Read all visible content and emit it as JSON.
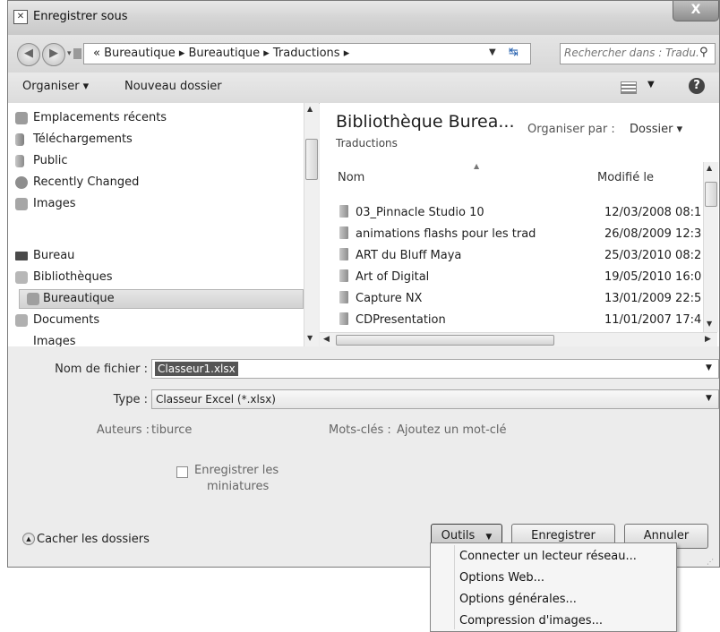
{
  "window": {
    "title": "Enregistrer sous",
    "close_glyph": "X"
  },
  "address": {
    "crumbs": "«  Bureautique  ▸  Bureautique  ▸  Traductions  ▸",
    "search_placeholder": "Rechercher dans : Tradu..."
  },
  "toolbar": {
    "organise": "Organiser ▾",
    "new_folder": "Nouveau dossier"
  },
  "nav": {
    "items": [
      {
        "label": "Emplacements récents"
      },
      {
        "label": "Téléchargements"
      },
      {
        "label": "Public"
      },
      {
        "label": "Recently Changed"
      },
      {
        "label": "Images"
      },
      {
        "label": "Bureau"
      },
      {
        "label": "Bibliothèques"
      },
      {
        "label": "Bureautique"
      },
      {
        "label": "Documents"
      },
      {
        "label": "Images"
      }
    ]
  },
  "library": {
    "title": "Bibliothèque Burea...",
    "subtitle": "Traductions",
    "arrange_label": "Organiser par :",
    "arrange_value": "Dossier ▾"
  },
  "files": {
    "col_name": "Nom",
    "col_modified": "Modifié le",
    "rows": [
      {
        "name": "03_Pinnacle Studio 10",
        "date": "12/03/2008 08:1"
      },
      {
        "name": "animations flashs pour les trad",
        "date": "26/08/2009 12:3"
      },
      {
        "name": "ART du Bluff Maya",
        "date": "25/03/2010 08:2"
      },
      {
        "name": "Art of Digital",
        "date": "19/05/2010 16:0"
      },
      {
        "name": "Capture NX",
        "date": "13/01/2009 22:5"
      },
      {
        "name": "CDPresentation",
        "date": "11/01/2007 17:4"
      }
    ]
  },
  "form": {
    "filename_label": "Nom de fichier :",
    "filename_value": "Classeur1.xlsx",
    "type_label": "Type :",
    "type_value": "Classeur Excel (*.xlsx)",
    "authors_label": "Auteurs :",
    "authors_value": "tiburce",
    "keywords_label": "Mots-clés :",
    "keywords_value": "Ajoutez un mot-clé",
    "thumb_label_1": "Enregistrer les",
    "thumb_label_2": "miniatures",
    "hide_folders": "Cacher les dossiers",
    "tools_button": "Outils",
    "save_button": "Enregistrer",
    "cancel_button": "Annuler"
  },
  "menu": {
    "items": [
      {
        "label": "Connecter un lecteur réseau..."
      },
      {
        "label": "Options Web..."
      },
      {
        "label": "Options générales..."
      },
      {
        "label": "Compression d'images..."
      }
    ]
  }
}
